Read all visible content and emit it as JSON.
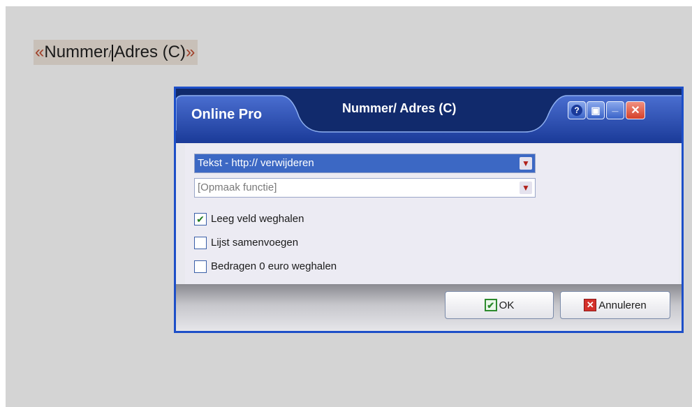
{
  "merge_field": {
    "open": "«",
    "text_before": "Nummer",
    "text_after": "Adres (C)",
    "close": "»",
    "slash_glyph": "/",
    "cursor": "|"
  },
  "dialog": {
    "app_name": "Online Pro",
    "title": "Nummer/ Adres (C)",
    "title_buttons": {
      "help_icon": "?",
      "restore_icon": "▣",
      "minimize_icon": "_",
      "close_icon": "✕"
    },
    "combos": [
      {
        "value": "Tekst - http:// verwijderen",
        "selected": true
      },
      {
        "value": "[Opmaak functie]",
        "selected": false
      }
    ],
    "dropdown_arrow": "▼",
    "checkboxes": [
      {
        "label": "Leeg veld weghalen",
        "checked": true,
        "mark": "✔"
      },
      {
        "label": "Lijst samenvoegen",
        "checked": false,
        "mark": ""
      },
      {
        "label": "Bedragen 0 euro weghalen",
        "checked": false,
        "mark": ""
      }
    ],
    "buttons": {
      "ok_label": "OK",
      "ok_icon": "✔",
      "cancel_label": "Annuleren",
      "cancel_icon": "✕"
    }
  },
  "colors": {
    "dialog_border": "#1d4fc8",
    "titlebar": "#1e3c8c",
    "selected_combo": "#3c68c4",
    "close_button": "#d4412a"
  }
}
